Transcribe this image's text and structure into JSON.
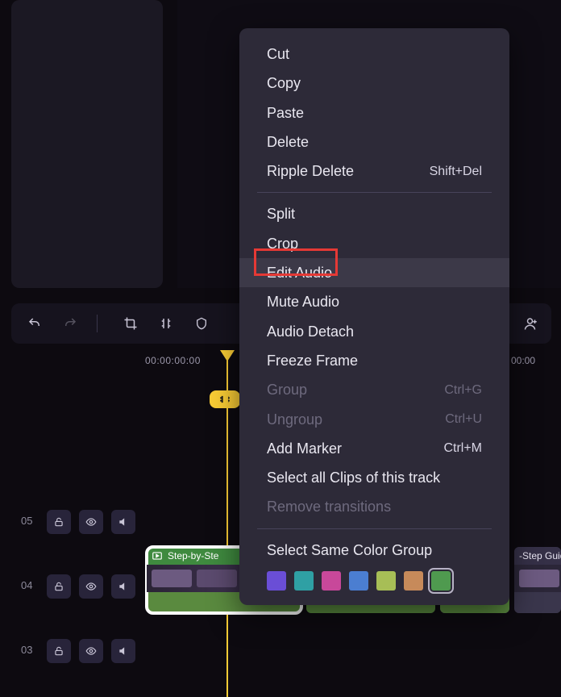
{
  "toolbar": {
    "timecode_start": "00:00:00:00",
    "timecode_right": "00:00"
  },
  "tracks": {
    "t05": "05",
    "t04": "04",
    "t03": "03"
  },
  "clips": {
    "c1_label": "Step-by-Ste",
    "c4_label": "-Step Guid"
  },
  "menu": {
    "cut": "Cut",
    "copy": "Copy",
    "paste": "Paste",
    "delete": "Delete",
    "ripple_delete": "Ripple Delete",
    "ripple_delete_short": "Shift+Del",
    "split": "Split",
    "crop": "Crop",
    "edit_audio": "Edit Audio",
    "mute_audio": "Mute Audio",
    "audio_detach": "Audio Detach",
    "freeze_frame": "Freeze Frame",
    "group": "Group",
    "group_short": "Ctrl+G",
    "ungroup": "Ungroup",
    "ungroup_short": "Ctrl+U",
    "add_marker": "Add Marker",
    "add_marker_short": "Ctrl+M",
    "select_all_clips": "Select all Clips of this track",
    "remove_transitions": "Remove transitions",
    "select_same_color": "Select Same Color Group"
  },
  "colors": {
    "purple": "#6a4ed6",
    "teal": "#2fa0a4",
    "magenta": "#c8489a",
    "blue": "#4b7ed1",
    "olive": "#a7be56",
    "orange": "#c78a5a",
    "green": "#4f9a4f"
  }
}
